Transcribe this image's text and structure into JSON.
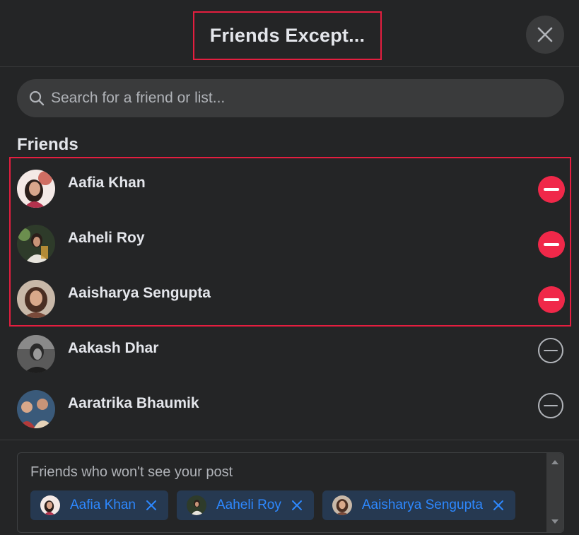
{
  "dialog": {
    "title": "Friends Except...",
    "close_icon": "close-icon"
  },
  "search": {
    "placeholder": "Search for a friend or list...",
    "value": "",
    "icon": "search-icon"
  },
  "friends_section": {
    "label": "Friends",
    "items": [
      {
        "name": "Aafia Khan",
        "excluded": true,
        "avatar_icon": "avatar-photo"
      },
      {
        "name": "Aaheli Roy",
        "excluded": true,
        "avatar_icon": "avatar-photo"
      },
      {
        "name": "Aaisharya Sengupta",
        "excluded": true,
        "avatar_icon": "avatar-photo"
      },
      {
        "name": "Aakash Dhar",
        "excluded": false,
        "avatar_icon": "avatar-photo"
      },
      {
        "name": "Aaratrika Bhaumik",
        "excluded": false,
        "avatar_icon": "avatar-photo"
      }
    ]
  },
  "excluded_panel": {
    "label": "Friends who won't see your post",
    "chips": [
      {
        "name": "Aafia Khan",
        "remove_icon": "close-icon"
      },
      {
        "name": "Aaheli Roy",
        "remove_icon": "close-icon"
      },
      {
        "name": "Aaisharya Sengupta",
        "remove_icon": "close-icon"
      }
    ]
  },
  "colors": {
    "background": "#242526",
    "surface": "#3a3b3c",
    "text_primary": "#e4e6eb",
    "text_secondary": "#b0b3b8",
    "remove_red": "#f02849",
    "highlight_red": "#e41e3f",
    "chip_bg": "#263951",
    "chip_text": "#2d88ff"
  }
}
